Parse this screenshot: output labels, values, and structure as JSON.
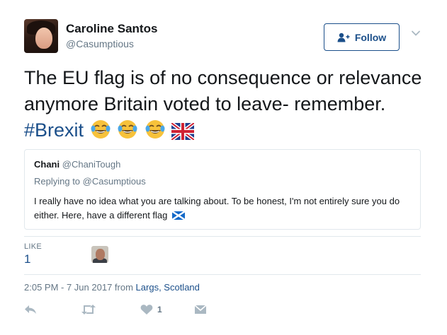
{
  "tweet": {
    "author_name": "Caroline Santos",
    "author_handle": "@Casumptious",
    "follow_label": "Follow",
    "text_main": "The EU flag is of no consequence or relevance anymore Britain voted to leave- remember.",
    "hashtag": "#Brexit",
    "emojis": [
      "face-with-tears-of-joy-icon",
      "face-with-tears-of-joy-icon",
      "face-with-tears-of-joy-icon",
      "uk-flag-icon"
    ]
  },
  "quote": {
    "name": "Chani",
    "handle": "@ChaniTough",
    "replying_prefix": "Replying to",
    "replying_handle": "@Casumptious",
    "text": "I really have no idea what you are talking about. To be honest, I'm not entirely sure you do either. Here, have a different flag"
  },
  "stats": {
    "like_label": "LIKE",
    "like_count": "1"
  },
  "meta": {
    "timestamp": "2:05 PM - 7 Jun 2017 from",
    "location": "Largs, Scotland"
  },
  "actions": {
    "like_count": "1"
  },
  "colors": {
    "accent": "#1b4f8a",
    "muted": "#657786",
    "border": "#e1e8ed",
    "text": "#14171a"
  }
}
